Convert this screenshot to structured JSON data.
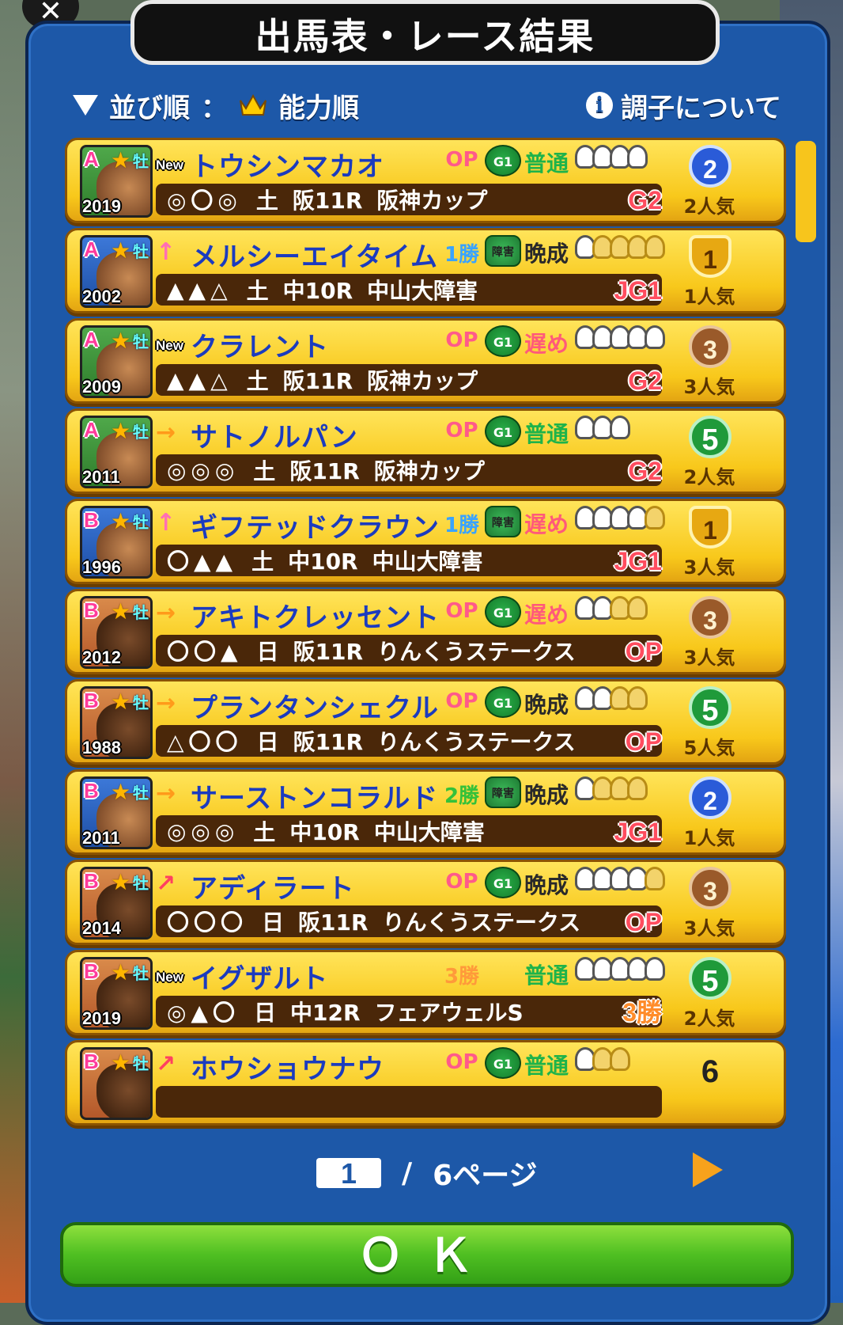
{
  "header": {
    "title": "出馬表・レース結果",
    "close_icon": "x-icon"
  },
  "sort": {
    "label": "並び順",
    "separator": "：",
    "value": "能力順",
    "icon": "crown-icon"
  },
  "info": {
    "label": "調子について",
    "icon": "info-icon"
  },
  "rows": [
    {
      "rank": "A",
      "year": "2019",
      "sex": "牡",
      "mark": "New",
      "name": "トウシンマカオ",
      "cls": "OP",
      "badge": "G1",
      "growth": "普通",
      "shoes": 4,
      "gold": 0,
      "marks": "◎〇◎",
      "day": "土",
      "race": "阪11R",
      "race_name": "阪神カップ",
      "grade": "G2",
      "place": "2",
      "pop": "2人気",
      "portrait": "gA"
    },
    {
      "rank": "A",
      "year": "2002",
      "sex": "牡",
      "mark": "↑",
      "name": "メルシーエイタイム",
      "cls": "1勝",
      "badge": "障害",
      "growth": "晩成",
      "shoes": 1,
      "gold": 4,
      "marks": "▲▲△",
      "day": "土",
      "race": "中10R",
      "race_name": "中山大障害",
      "grade": "JG1",
      "place": "1",
      "pop": "1人気",
      "portrait": "bB"
    },
    {
      "rank": "A",
      "year": "2009",
      "sex": "牡",
      "mark": "New",
      "name": "クラレント",
      "cls": "OP",
      "badge": "G1",
      "growth": "遅め",
      "shoes": 5,
      "gold": 0,
      "marks": "▲▲△",
      "day": "土",
      "race": "阪11R",
      "race_name": "阪神カップ",
      "grade": "G2",
      "place": "3",
      "pop": "3人気",
      "portrait": "gA"
    },
    {
      "rank": "A",
      "year": "2011",
      "sex": "牡",
      "mark": "→",
      "name": "サトノルパン",
      "cls": "OP",
      "badge": "G1",
      "growth": "普通",
      "shoes": 3,
      "gold": 0,
      "marks": "◎◎◎",
      "day": "土",
      "race": "阪11R",
      "race_name": "阪神カップ",
      "grade": "G2",
      "place": "5",
      "pop": "2人気",
      "portrait": "gA"
    },
    {
      "rank": "B",
      "year": "1996",
      "sex": "牡",
      "mark": "↑",
      "name": "ギフテッドクラウン",
      "cls": "1勝",
      "badge": "障害",
      "growth": "遅め",
      "shoes": 4,
      "gold": 1,
      "marks": "〇▲▲",
      "day": "土",
      "race": "中10R",
      "race_name": "中山大障害",
      "grade": "JG1",
      "place": "1",
      "pop": "3人気",
      "portrait": "bB"
    },
    {
      "rank": "B",
      "year": "2012",
      "sex": "牡",
      "mark": "→",
      "name": "アキトクレッセント",
      "cls": "OP",
      "badge": "G1",
      "growth": "遅め",
      "shoes": 2,
      "gold": 2,
      "marks": "〇〇▲",
      "day": "日",
      "race": "阪11R",
      "race_name": "りんくうステークス",
      "grade": "OP",
      "place": "3",
      "pop": "3人気",
      "portrait": "oB"
    },
    {
      "rank": "B",
      "year": "1988",
      "sex": "牡",
      "mark": "→",
      "name": "プランタンシェクル",
      "cls": "OP",
      "badge": "G1",
      "growth": "晩成",
      "shoes": 2,
      "gold": 2,
      "marks": "△〇〇",
      "day": "日",
      "race": "阪11R",
      "race_name": "りんくうステークス",
      "grade": "OP",
      "place": "5",
      "pop": "5人気",
      "portrait": "oB"
    },
    {
      "rank": "B",
      "year": "2011",
      "sex": "牡",
      "mark": "→",
      "name": "サーストンコラルド",
      "cls": "2勝",
      "badge": "障害",
      "growth": "晩成",
      "shoes": 1,
      "gold": 3,
      "marks": "◎◎◎",
      "day": "土",
      "race": "中10R",
      "race_name": "中山大障害",
      "grade": "JG1",
      "place": "2",
      "pop": "1人気",
      "portrait": "bB"
    },
    {
      "rank": "B",
      "year": "2014",
      "sex": "牡",
      "mark": "↗",
      "name": "アディラート",
      "cls": "OP",
      "badge": "G1",
      "growth": "晩成",
      "shoes": 4,
      "gold": 1,
      "marks": "〇〇〇",
      "day": "日",
      "race": "阪11R",
      "race_name": "りんくうステークス",
      "grade": "OP",
      "place": "3",
      "pop": "3人気",
      "portrait": "oB"
    },
    {
      "rank": "B",
      "year": "2019",
      "sex": "牡",
      "mark": "New",
      "name": "イグザルト",
      "cls": "3勝",
      "badge": "",
      "growth": "普通",
      "shoes": 5,
      "gold": 0,
      "marks": "◎▲〇",
      "day": "日",
      "race": "中12R",
      "race_name": "フェアウェルS",
      "grade": "3勝",
      "place": "5",
      "pop": "2人気",
      "portrait": "oB"
    },
    {
      "rank": "B",
      "year": "",
      "sex": "牡",
      "mark": "↗",
      "name": "ホウショウナウ",
      "cls": "OP",
      "badge": "G1",
      "growth": "普通",
      "shoes": 1,
      "gold": 2,
      "marks": "",
      "day": "",
      "race": "",
      "race_name": "",
      "grade": "",
      "place": "6",
      "pop": "",
      "portrait": "oB"
    }
  ],
  "pager": {
    "current": "1",
    "separator": "/",
    "total": "6ページ",
    "next_icon": "next-arrow-icon"
  },
  "ok_button": "ＯＫ"
}
